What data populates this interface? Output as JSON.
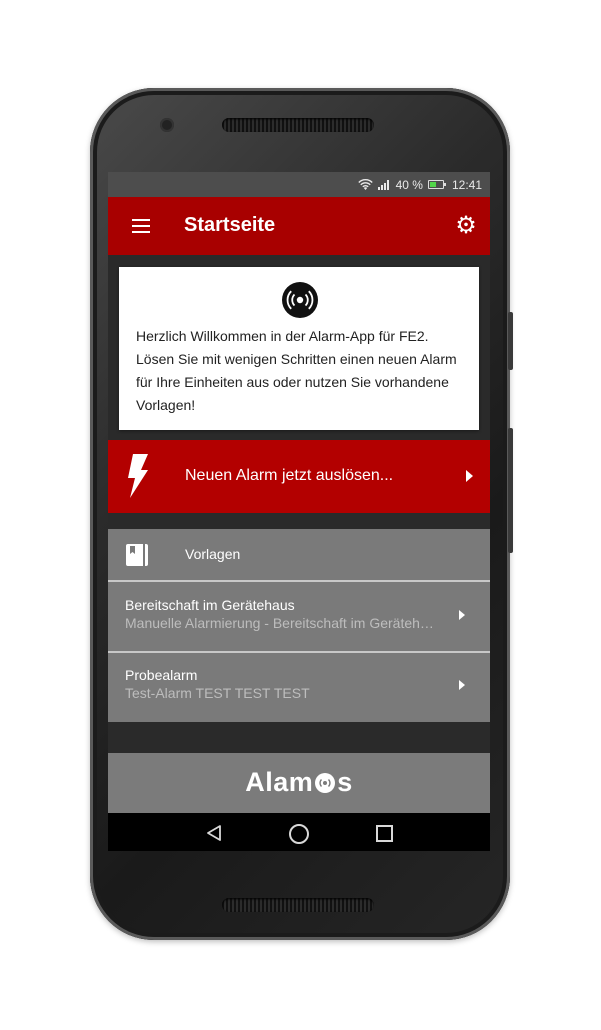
{
  "status_bar": {
    "signal_label": "",
    "battery_percent": "40 %",
    "time": "12:41",
    "icons": [
      "wifi-icon",
      "signal-icon",
      "battery-icon"
    ]
  },
  "app_bar": {
    "title": "Startseite",
    "menu_icon": "hamburger-menu-icon",
    "settings_icon": "gear-icon",
    "background": "#a80000"
  },
  "welcome": {
    "icon": "alarm-broadcast-icon",
    "text": "Herzlich Willkommen in der Alarm-App für FE2. Lösen Sie mit wenigen Schritten einen neuen Alarm für Ihre Einheiten aus oder nutzen Sie vorhandene Vorlagen!"
  },
  "alarm_action": {
    "label": "Neuen Alarm jetzt auslösen...",
    "icon": "lightning-bolt-icon",
    "background": "#b30000"
  },
  "templates": {
    "title": "Vorlagen",
    "icon": "book-icon",
    "items": [
      {
        "name": "Bereitschaft im Gerätehaus",
        "description": "Manuelle Alarmierung - Bereitschaft im Gerätehaus"
      },
      {
        "name": "Probealarm",
        "description": "Test-Alarm TEST TEST TEST"
      }
    ]
  },
  "footer": {
    "logo_text_before": "Alam",
    "logo_text_after": "s"
  },
  "nav_bar": {
    "icons": [
      "back-icon",
      "home-icon",
      "recent-apps-icon"
    ]
  }
}
